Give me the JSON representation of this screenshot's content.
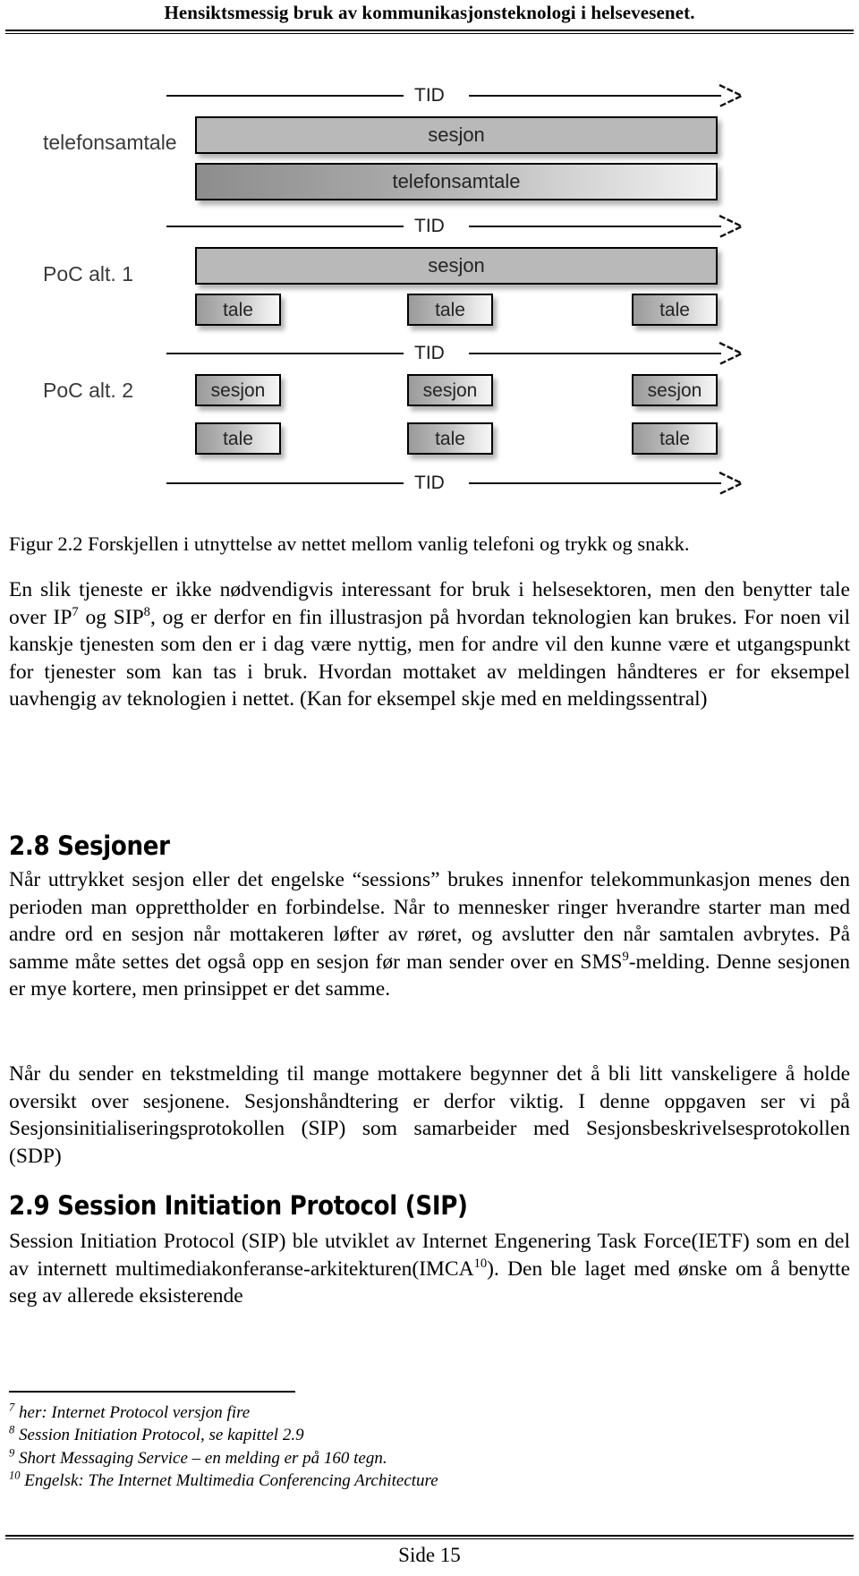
{
  "header": {
    "running_title": "Hensiktsmessig bruk av kommunikasjonsteknologi i helsevesenet."
  },
  "figure": {
    "row_labels": [
      "telefonsamtale",
      "PoC alt. 1",
      "PoC alt. 2"
    ],
    "axis_label": "TID",
    "boxes": {
      "sesjon": "sesjon",
      "telefonsamtale": "telefonsamtale",
      "tale": "tale"
    },
    "rows": [
      {
        "label": "telefonsamtale",
        "bars": [
          "sesjon",
          "telefonsamtale"
        ]
      },
      {
        "label": "PoC alt. 1",
        "bars": [
          "sesjon"
        ],
        "segments": [
          "tale",
          "tale",
          "tale"
        ]
      },
      {
        "label": "PoC alt. 2",
        "sessions": [
          "sesjon",
          "sesjon",
          "sesjon"
        ],
        "segments": [
          "tale",
          "tale",
          "tale"
        ]
      }
    ]
  },
  "caption": "Figur 2.2 Forskjellen i utnyttelse av nettet mellom vanlig telefoni og trykk og snakk.",
  "body": {
    "para_1_a": "En slik tjeneste er ikke nødvendigvis interessant for bruk i helsesektoren, men den benytter tale over IP",
    "para_1_sup7": "7",
    "para_1_b": " og SIP",
    "para_1_sup8": "8",
    "para_1_c": ", og er derfor en fin illustrasjon på hvordan teknologien kan brukes. For noen vil kanskje tjenesten som den er i dag være nyttig, men for andre vil den kunne være et utgangspunkt for tjenester som kan tas i bruk. Hvordan mottaket av meldingen håndteres er for eksempel uavhengig av teknologien i nettet. (Kan for eksempel skje med en meldingssentral)",
    "heading_28": "2.8  Sesjoner",
    "para_2_a": "Når uttrykket sesjon eller det engelske “sessions” brukes innenfor telekommunkasjon menes den perioden man opprettholder en forbindelse. Når to mennesker ringer hverandre starter man med andre ord en sesjon når mottakeren løfter av røret, og avslutter den når samtalen avbrytes. På samme måte settes det også opp en sesjon før man sender over en SMS",
    "para_2_sup9": "9",
    "para_2_b": "-melding. Denne sesjonen er mye kortere, men prinsippet er det samme.",
    "para_3": "Når du sender en tekstmelding til mange mottakere begynner det å bli litt vanskeligere å holde oversikt over sesjonene. Sesjonshåndtering er derfor viktig. I denne oppgaven ser vi på Sesjonsinitialiseringsprotokollen (SIP) som samarbeider med Sesjonsbeskrivelsesprotokollen (SDP)",
    "heading_29": "2.9  Session Initiation Protocol (SIP)",
    "para_4_a": "Session Initiation Protocol (SIP) ble utviklet av Internet Engenering Task Force(IETF) som en del av internett multimediakonferanse-arkitekturen(IMCA",
    "para_4_sup10": "10",
    "para_4_b": "). Den ble laget med ønske om å benytte seg av allerede eksisterende"
  },
  "footnotes": [
    {
      "marker": "7",
      "text": " her: Internet Protocol versjon fire"
    },
    {
      "marker": "8",
      "text": " Session Initiation Protocol, se kapittel 2.9"
    },
    {
      "marker": "9",
      "text": " Short Messaging Service – en melding er på 160 tegn."
    },
    {
      "marker": "10",
      "text": " Engelsk: The Internet Multimedia Conferencing Architecture"
    }
  ],
  "footer": {
    "page_label": "Side 15"
  }
}
